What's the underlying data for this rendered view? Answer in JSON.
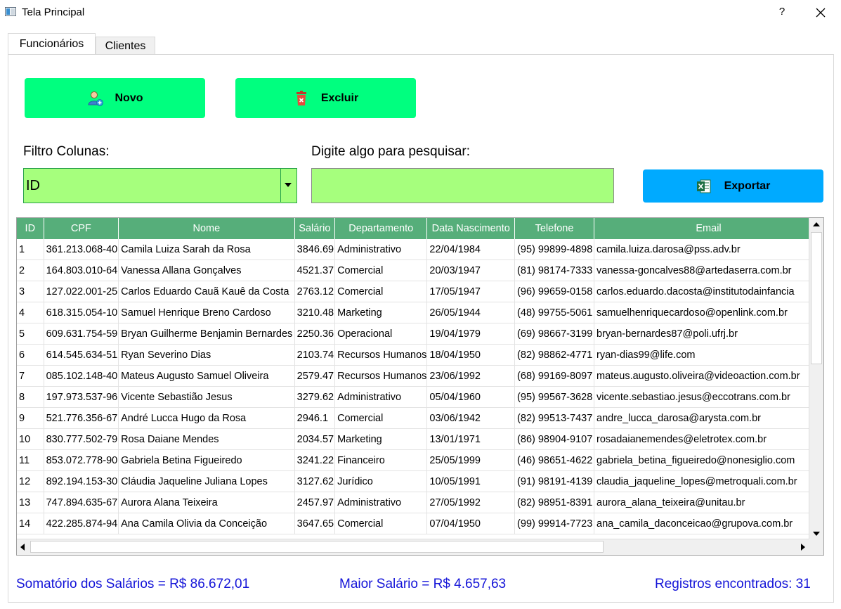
{
  "window": {
    "title": "Tela Principal",
    "help": "?"
  },
  "tabs": [
    {
      "label": "Funcionários"
    },
    {
      "label": "Clientes"
    }
  ],
  "toolbar": {
    "new_label": "Novo",
    "delete_label": "Excluir",
    "export_label": "Exportar"
  },
  "filter": {
    "label": "Filtro Colunas:",
    "selected": "ID"
  },
  "search": {
    "label": "Digite algo para pesquisar:",
    "value": ""
  },
  "table": {
    "columns": [
      "ID",
      "CPF",
      "Nome",
      "Salário",
      "Departamento",
      "Data Nascimento",
      "Telefone",
      "Email"
    ],
    "rows": [
      [
        "1",
        "361.213.068-40",
        "Camila Luiza Sarah da Rosa",
        "3846.69",
        "Administrativo",
        "22/04/1984",
        "(95) 99899-4898",
        "camila.luiza.darosa@pss.adv.br"
      ],
      [
        "2",
        "164.803.010-64",
        "Vanessa Allana Gonçalves",
        "4521.37",
        "Comercial",
        "20/03/1947",
        "(81) 98174-7333",
        "vanessa-goncalves88@artedaserra.com.br"
      ],
      [
        "3",
        "127.022.001-25",
        "Carlos Eduardo Cauã Kauê da Costa",
        "2763.12",
        "Comercial",
        "17/05/1947",
        "(96) 99659-0158",
        "carlos.eduardo.dacosta@institutodainfancia"
      ],
      [
        "4",
        "618.315.054-10",
        "Samuel Henrique Breno Cardoso",
        "3210.48",
        "Marketing",
        "26/05/1944",
        "(48) 99755-5061",
        "samuelhenriquecardoso@openlink.com.br"
      ],
      [
        "5",
        "609.631.754-59",
        "Bryan Guilherme Benjamin Bernardes",
        "2250.36",
        "Operacional",
        "19/04/1979",
        "(69) 98667-3199",
        "bryan-bernardes87@poli.ufrj.br"
      ],
      [
        "6",
        "614.545.634-51",
        "Ryan Severino Dias",
        "2103.74",
        "Recursos Humanos",
        "18/04/1950",
        "(82) 98862-4771",
        "ryan-dias99@life.com"
      ],
      [
        "7",
        "085.102.148-40",
        "Mateus Augusto Samuel Oliveira",
        "2579.47",
        "Recursos Humanos",
        "23/06/1992",
        "(68) 99169-8097",
        "mateus.augusto.oliveira@videoaction.com.br"
      ],
      [
        "8",
        "197.973.537-96",
        "Vicente Sebastião Jesus",
        "3279.62",
        "Administrativo",
        "05/04/1960",
        "(95) 99567-3628",
        "vicente.sebastiao.jesus@eccotrans.com.br"
      ],
      [
        "9",
        "521.776.356-67",
        "André Lucca Hugo da Rosa",
        "2946.1",
        "Comercial",
        "03/06/1942",
        "(82) 99513-7437",
        "andre_lucca_darosa@arysta.com.br"
      ],
      [
        "10",
        "830.777.502-79",
        "Rosa Daiane Mendes",
        "2034.57",
        "Marketing",
        "13/01/1971",
        "(86) 98904-9107",
        "rosadaianemendes@eletrotex.com.br"
      ],
      [
        "11",
        "853.072.778-90",
        "Gabriela Betina Figueiredo",
        "3241.22",
        "Financeiro",
        "25/05/1999",
        "(46) 98651-4622",
        "gabriela_betina_figueiredo@nonesiglio.com"
      ],
      [
        "12",
        "892.194.153-30",
        "Cláudia Jaqueline Juliana Lopes",
        "3127.62",
        "Jurídico",
        "10/05/1991",
        "(91) 98191-4139",
        "claudia_jaqueline_lopes@metroquali.com.br"
      ],
      [
        "13",
        "747.894.635-67",
        "Aurora Alana Teixeira",
        "2457.97",
        "Administrativo",
        "27/05/1992",
        "(82) 98951-8391",
        "aurora_alana_teixeira@unitau.br"
      ],
      [
        "14",
        "422.285.874-94",
        "Ana Camila Olivia da Conceição",
        "3647.65",
        "Comercial",
        "07/04/1950",
        "(99) 99914-7723",
        "ana_camila_daconceicao@grupova.com.br"
      ]
    ]
  },
  "footer": {
    "salary_sum": "Somatório dos Salários = R$ 86.672,01",
    "max_salary": "Maior Salário = R$ 4.657,63",
    "records": "Registros encontrados: 31"
  },
  "icons": {
    "new": "add-user-icon",
    "delete": "trash-icon",
    "export": "excel-icon",
    "close": "close-icon"
  },
  "colors": {
    "action_button": "#00ff7f",
    "export_button": "#00aaff",
    "input_bg": "#a6ff7d",
    "header_bg": "#56ae7a",
    "footer_text": "#1414d8"
  }
}
